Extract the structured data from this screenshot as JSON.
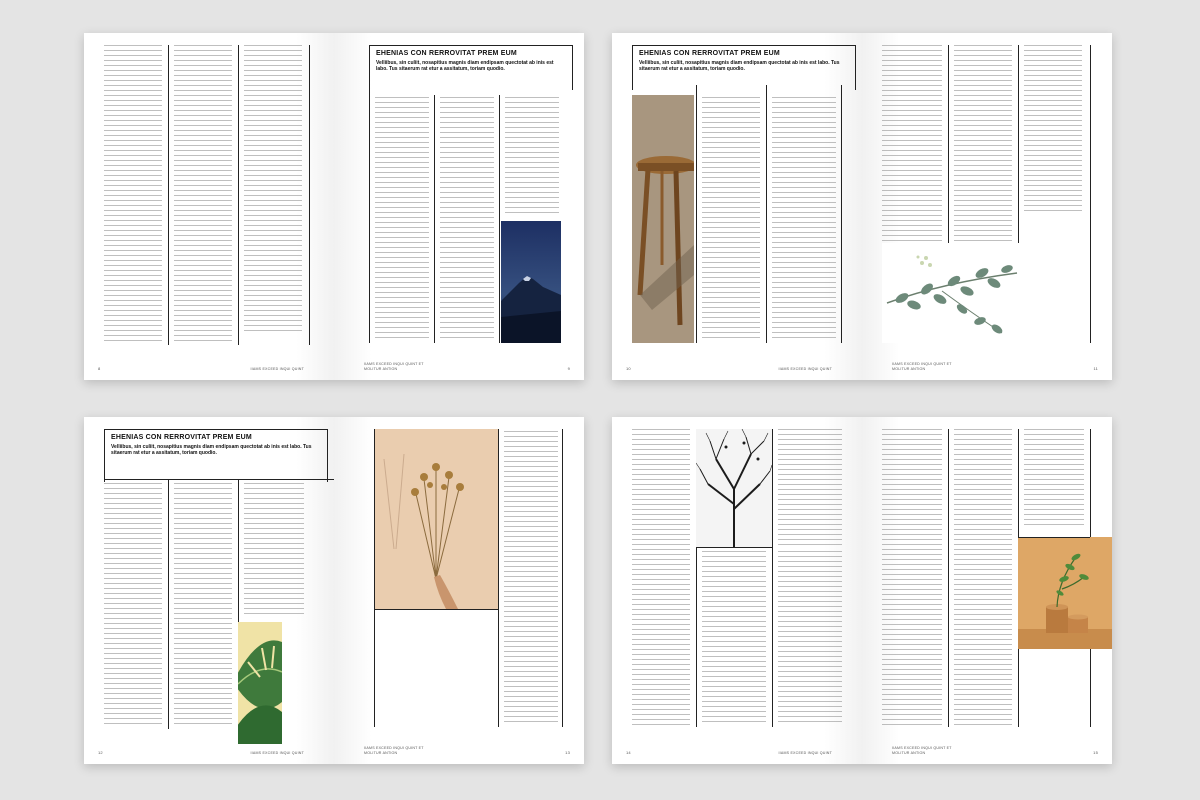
{
  "spreads": [
    {
      "left_page": {
        "number": "8",
        "running_head": "IIAMS EXCEED INQUI QUINT"
      },
      "right_page": {
        "number": "9",
        "running_head": "IIAMS EXCEED INQUI QUINT ET MOLITUR ANTION"
      },
      "headline": "EHENIAS CON RERROVITAT PREM EUM",
      "subhead": "Velliibus, sin culiit, nosapitius magnis diam endipsam quectotat ab inis est labo. Tus sitaerum rat etur a assitatum, toriam quodio.",
      "image": "mountain-photo"
    },
    {
      "left_page": {
        "number": "10",
        "running_head": "IIAMS EXCEED INQUI QUINT"
      },
      "right_page": {
        "number": "11",
        "running_head": "IIAMS EXCEED INQUI QUINT ET MOLITUR ANTION"
      },
      "headline": "EHENIAS CON RERROVITAT PREM EUM",
      "subhead": "Velliibus, sin culiit, nosapitius magnis diam endipsam quectotat ab inis est labo. Tus sitaerum rat etur a assitatum, toriam quodio.",
      "images": [
        "wooden-stool-photo",
        "eucalyptus-photo"
      ]
    },
    {
      "left_page": {
        "number": "12",
        "running_head": "IIAMS EXCEED INQUI QUINT"
      },
      "right_page": {
        "number": "13",
        "running_head": "IIAMS EXCEED INQUI QUINT ET MOLITUR ANTION"
      },
      "headline": "EHENIAS CON RERROVITAT PREM EUM",
      "subhead": "Velliibus, sin culiit, nosapitius magnis diam endipsam quectotat ab inis est labo. Tus sitaerum rat etur a assitatum, toriam quodio.",
      "images": [
        "monstera-leaf-photo",
        "dried-flowers-photo"
      ]
    },
    {
      "left_page": {
        "number": "14",
        "running_head": "IIAMS EXCEED INQUI QUINT"
      },
      "right_page": {
        "number": "15",
        "running_head": "IIAMS EXCEED INQUI QUINT ET MOLITUR ANTION"
      },
      "images": [
        "bare-tree-photo",
        "plant-vase-photo"
      ]
    }
  ]
}
